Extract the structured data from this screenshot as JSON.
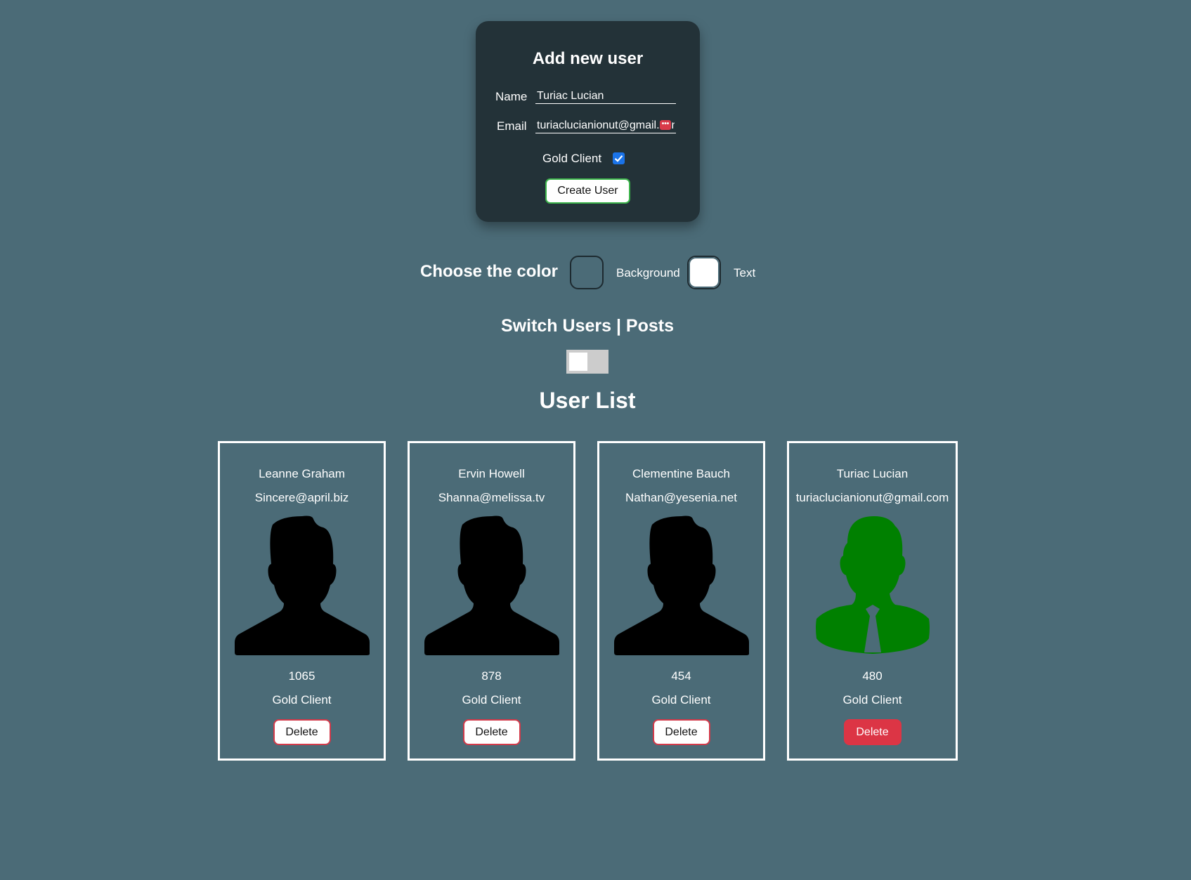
{
  "form": {
    "title": "Add new user",
    "name_label": "Name",
    "name_value": "Turiac Lucian",
    "email_label": "Email",
    "email_value": "turiaclucianionut@gmail.com",
    "gold_label": "Gold Client",
    "gold_checked": true,
    "create_label": "Create User"
  },
  "color_picker": {
    "title": "Choose the color",
    "background_label": "Background",
    "background_color": "#4b6b77",
    "text_label": "Text",
    "text_color": "#ffffff"
  },
  "switch": {
    "title": "Switch Users | Posts",
    "on": false
  },
  "user_list": {
    "title": "User List",
    "users": [
      {
        "name": "Leanne Graham",
        "email": "Sincere@april.biz",
        "salary": "1065",
        "status": "Gold Client",
        "avatar": "person-silhouette-icon",
        "avatar_color": "#000000",
        "delete_label": "Delete"
      },
      {
        "name": "Ervin Howell",
        "email": "Shanna@melissa.tv",
        "salary": "878",
        "status": "Gold Client",
        "avatar": "person-silhouette-icon",
        "avatar_color": "#000000",
        "delete_label": "Delete"
      },
      {
        "name": "Clementine Bauch",
        "email": "Nathan@yesenia.net",
        "salary": "454",
        "status": "Gold Client",
        "avatar": "person-silhouette-icon",
        "avatar_color": "#000000",
        "delete_label": "Delete"
      },
      {
        "name": "Turiac Lucian",
        "email": "turiaclucianionut@gmail.com",
        "salary": "480",
        "status": "Gold Client",
        "avatar": "businessman-icon",
        "avatar_color": "#008000",
        "delete_label": "Delete"
      }
    ]
  },
  "colors": {
    "page_bg": "#4b6b77",
    "card_bg": "#233238",
    "create_border": "#3bb34a",
    "delete_red": "#dc3545",
    "checkbox_blue": "#1a73e8"
  }
}
